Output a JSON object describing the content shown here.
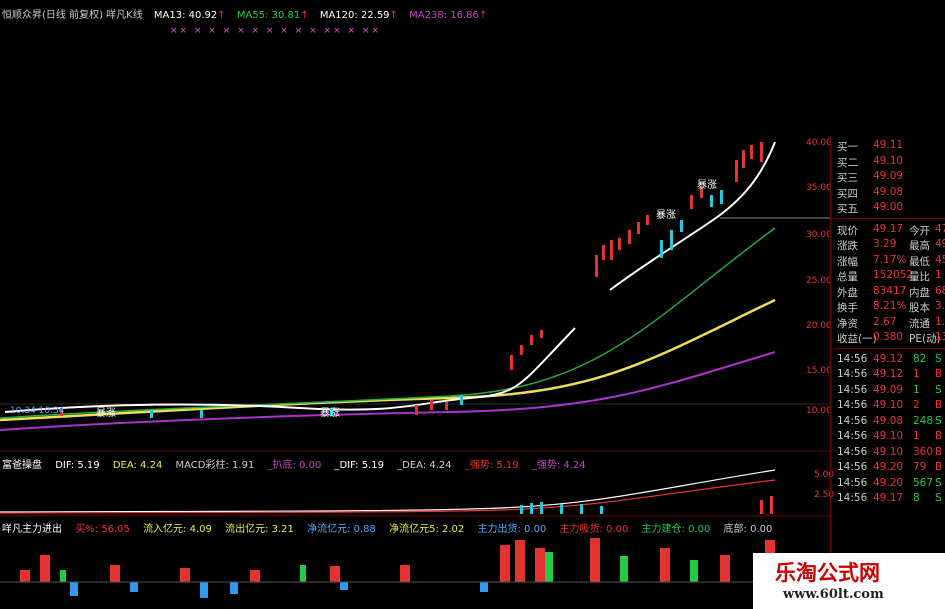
{
  "header": {
    "title": "恒顺众昇(日线 前复权) 咩凡K线",
    "ma": [
      {
        "label": "MA13: 40.92",
        "color": "#ffffff"
      },
      {
        "label": "MA55: 30.81",
        "color": "#22cc44"
      },
      {
        "label": "MA120: 22.59",
        "color": "#ffffff"
      },
      {
        "label": "MA238: 16.86",
        "color": "#cc44cc"
      }
    ]
  },
  "marks": "××  ×  ×  ×   ×   ×  ×  ×   ×  ×  ××  ×  ××",
  "price_axis": [
    "40.00",
    "35.00",
    "30.00",
    "25.00",
    "20.00",
    "15.00",
    "10.00"
  ],
  "chart_labels": {
    "ma_note": "10.34  10.34",
    "fund_a": "暴涨",
    "fund_b": "建仓",
    "fund_c": "洗盘"
  },
  "macd_panel": {
    "title": "富爸操盘",
    "items": [
      "DIF: 5.19",
      "DEA: 4.24",
      "MACD彩柱: 1.91",
      "_扒底: 0.00",
      "_DIF: 5.19",
      "_DEA: 4.24",
      "_强势: 5.19",
      "_强势: 4.24"
    ],
    "axis": [
      "5.00",
      "2.50"
    ]
  },
  "flow_panel": {
    "title": "咩凡主力进出",
    "items": [
      "买%: 56.05",
      "流入亿元: 4.09",
      "流出亿元: 3.21",
      "净流亿元: 0.88",
      "净流亿元5: 2.02",
      "主力出货: 0.00",
      "主力吸货: 0.00",
      "主力建仓: 0.00",
      "底部: 0.00"
    ]
  },
  "quote": {
    "bids": [
      {
        "label": "买一",
        "price": "49.11"
      },
      {
        "label": "买二",
        "price": "49.10"
      },
      {
        "label": "买三",
        "price": "49.09"
      },
      {
        "label": "买四",
        "price": "49.08"
      },
      {
        "label": "买五",
        "price": "49.00"
      }
    ],
    "stats": [
      {
        "l1": "现价",
        "v1": "49.17",
        "l2": "今开",
        "v2": "47"
      },
      {
        "l1": "涨跌",
        "v1": "3.29",
        "l2": "最高",
        "v2": "49"
      },
      {
        "l1": "涨幅",
        "v1": "7.17%",
        "l2": "最低",
        "v2": "45"
      },
      {
        "l1": "总量",
        "v1": "152052",
        "l2": "量比",
        "v2": "1"
      },
      {
        "l1": "外盘",
        "v1": "83417",
        "l2": "内盘",
        "v2": "68"
      },
      {
        "l1": "换手",
        "v1": "8.21%",
        "l2": "股本",
        "v2": "3.0"
      },
      {
        "l1": "净资",
        "v1": "2.67",
        "l2": "流通",
        "v2": "1.8"
      },
      {
        "l1": "收益(一)",
        "v1": "0.380",
        "l2": "PE(动)",
        "v2": "13"
      }
    ],
    "ticks": [
      {
        "time": "14:56",
        "price": "49.12",
        "vol": "82",
        "bs": "S"
      },
      {
        "time": "14:56",
        "price": "49.12",
        "vol": "1",
        "bs": "B"
      },
      {
        "time": "14:56",
        "price": "49.09",
        "vol": "1",
        "bs": "S"
      },
      {
        "time": "14:56",
        "price": "49.10",
        "vol": "2",
        "bs": "B"
      },
      {
        "time": "14:56",
        "price": "49.08",
        "vol": "248",
        "bs": "S"
      },
      {
        "time": "14:56",
        "price": "49.10",
        "vol": "1",
        "bs": "B"
      },
      {
        "time": "14:56",
        "price": "49.10",
        "vol": "360",
        "bs": "B"
      },
      {
        "time": "14:56",
        "price": "49.20",
        "vol": "79",
        "bs": "B"
      },
      {
        "time": "14:56",
        "price": "49.20",
        "vol": "567",
        "bs": "S"
      },
      {
        "time": "14:56",
        "price": "49.17",
        "vol": "8",
        "bs": "S"
      }
    ]
  },
  "watermark": {
    "name": "乐淘公式网",
    "url": "www.60lt.com"
  },
  "colors": {
    "up": "#e33333",
    "down": "#22ccdd",
    "ma13": "#ffffff",
    "ma55": "#22aa44",
    "ma120": "#eedd55",
    "ma238": "#aa33cc"
  }
}
